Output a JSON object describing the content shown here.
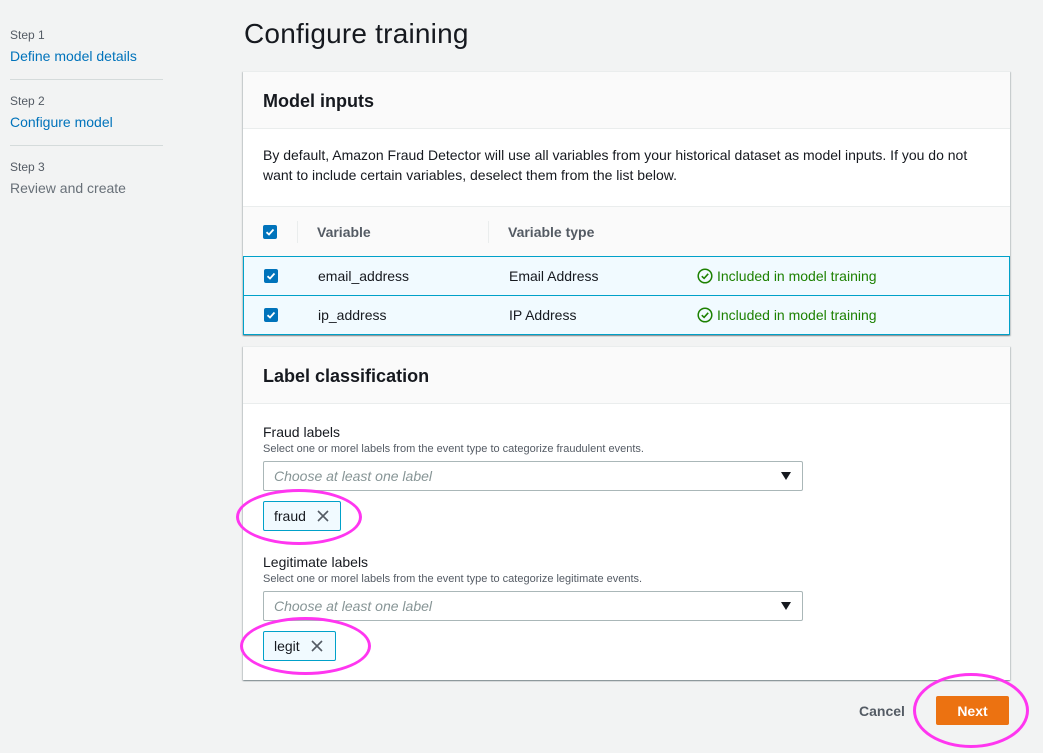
{
  "wizard": {
    "steps": [
      {
        "num": "Step 1",
        "name": "Define model details"
      },
      {
        "num": "Step 2",
        "name": "Configure model"
      },
      {
        "num": "Step 3",
        "name": "Review and create"
      }
    ]
  },
  "page_title": "Configure training",
  "model_inputs": {
    "title": "Model inputs",
    "description": "By default, Amazon Fraud Detector will use all variables from your historical dataset as model inputs. If you do not want to include certain variables, deselect them from the list below.",
    "columns": [
      "Variable",
      "Variable type"
    ],
    "rows": [
      {
        "variable": "email_address",
        "type": "Email Address",
        "status": "Included in model training",
        "checked": true
      },
      {
        "variable": "ip_address",
        "type": "IP Address",
        "status": "Included in model training",
        "checked": true
      }
    ]
  },
  "label_classification": {
    "title": "Label classification",
    "fraud": {
      "label": "Fraud labels",
      "description": "Select one or morel labels from the event type to categorize fraudulent events.",
      "placeholder": "Choose at least one label",
      "token": "fraud"
    },
    "legit": {
      "label": "Legitimate labels",
      "description": "Select one or morel labels from the event type to categorize legitimate events.",
      "placeholder": "Choose at least one label",
      "token": "legit"
    }
  },
  "actions": {
    "cancel": "Cancel",
    "next": "Next"
  },
  "colors": {
    "accent": "#0073bb",
    "primary_button": "#ec7211",
    "success": "#1d8102",
    "annotation": "#ff36f0"
  }
}
